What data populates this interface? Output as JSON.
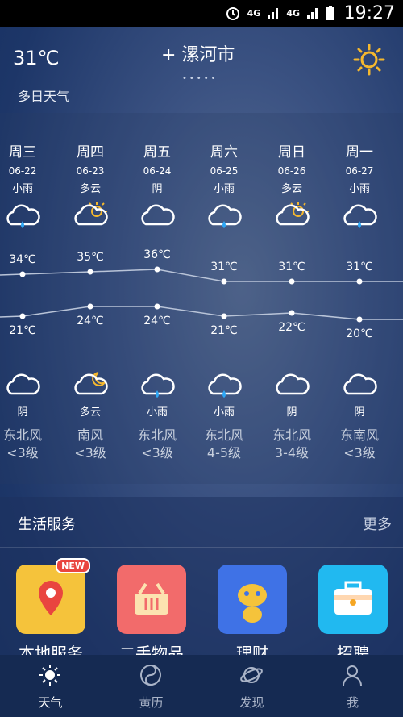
{
  "status": {
    "time": "19:27",
    "net1": "4G",
    "net2": "4G"
  },
  "header": {
    "current_temp": "31℃",
    "city": "+ 漯河市",
    "page_dots": "•••••"
  },
  "section_top_title": "多日天气",
  "forecast": [
    {
      "weekday": "周三",
      "date": "06-22",
      "day_cond": "小雨",
      "day_icon": "rain-cloud-icon",
      "high": 34,
      "high_label": "34℃",
      "low": 21,
      "low_label": "21℃",
      "night_icon": "cloud-icon",
      "night_cond": "阴",
      "wind_dir": "东北风",
      "wind_level": "<3级"
    },
    {
      "weekday": "周四",
      "date": "06-23",
      "day_cond": "多云",
      "day_icon": "partly-sunny-icon",
      "high": 35,
      "high_label": "35℃",
      "low": 24,
      "low_label": "24℃",
      "night_icon": "moon-cloud-icon",
      "night_cond": "多云",
      "wind_dir": "南风",
      "wind_level": "<3级"
    },
    {
      "weekday": "周五",
      "date": "06-24",
      "day_cond": "阴",
      "day_icon": "cloud-icon",
      "high": 36,
      "high_label": "36℃",
      "low": 24,
      "low_label": "24℃",
      "night_icon": "rain-cloud-icon",
      "night_cond": "小雨",
      "wind_dir": "东北风",
      "wind_level": "<3级"
    },
    {
      "weekday": "周六",
      "date": "06-25",
      "day_cond": "小雨",
      "day_icon": "rain-cloud-icon",
      "high": 31,
      "high_label": "31℃",
      "low": 21,
      "low_label": "21℃",
      "night_icon": "rain-cloud-icon",
      "night_cond": "小雨",
      "wind_dir": "东北风",
      "wind_level": "4-5级"
    },
    {
      "weekday": "周日",
      "date": "06-26",
      "day_cond": "多云",
      "day_icon": "partly-sunny-icon",
      "high": 31,
      "high_label": "31℃",
      "low": 22,
      "low_label": "22℃",
      "night_icon": "cloud-icon",
      "night_cond": "阴",
      "wind_dir": "东北风",
      "wind_level": "3-4级"
    },
    {
      "weekday": "周一",
      "date": "06-27",
      "day_cond": "小雨",
      "day_icon": "rain-cloud-icon",
      "high": 31,
      "high_label": "31℃",
      "low": 20,
      "low_label": "20℃",
      "night_icon": "cloud-icon",
      "night_cond": "阴",
      "wind_dir": "东南风",
      "wind_level": "<3级"
    }
  ],
  "services": {
    "title": "生活服务",
    "more": "更多",
    "items": [
      {
        "label": "本地服务",
        "color": "#f5c33b",
        "icon": "map-pin-icon",
        "badge": "NEW"
      },
      {
        "label": "二手物品",
        "color": "#f26b6b",
        "icon": "basket-icon"
      },
      {
        "label": "理财",
        "color": "#3f72e6",
        "icon": "mascot-icon"
      },
      {
        "label": "招聘",
        "color": "#21b9f0",
        "icon": "briefcase-icon"
      }
    ]
  },
  "tabs": [
    {
      "label": "天气",
      "active": true
    },
    {
      "label": "黄历",
      "active": false
    },
    {
      "label": "发现",
      "active": false
    },
    {
      "label": "我",
      "active": false
    }
  ]
}
